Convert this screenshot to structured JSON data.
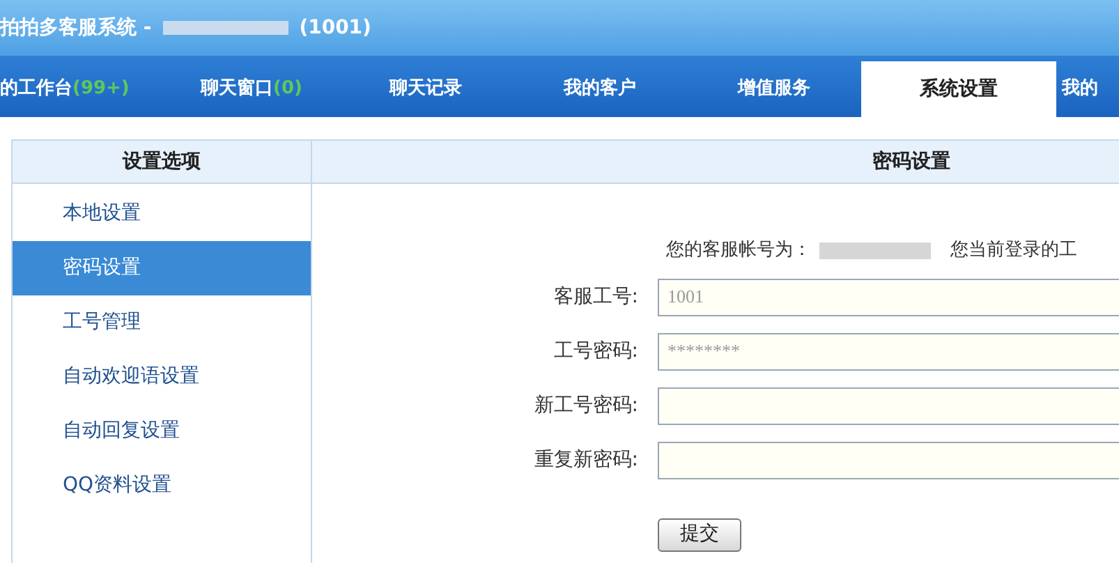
{
  "window": {
    "title": "拍拍多客服系统 -",
    "title_suffix": "(1001)"
  },
  "tabs": [
    {
      "label": "的工作台",
      "count": "(99+)",
      "selected": false
    },
    {
      "label": "聊天窗口",
      "count": "(0)",
      "selected": false
    },
    {
      "label": "聊天记录",
      "selected": false
    },
    {
      "label": "我的客户",
      "selected": false
    },
    {
      "label": "增值服务",
      "selected": false
    },
    {
      "label": "系统设置",
      "selected": true
    },
    {
      "label": "我的",
      "selected": false
    }
  ],
  "sidebar": {
    "title": "设置选项",
    "items": [
      {
        "label": "本地设置",
        "selected": false
      },
      {
        "label": "密码设置",
        "selected": true
      },
      {
        "label": "工号管理",
        "selected": false
      },
      {
        "label": "自动欢迎语设置",
        "selected": false
      },
      {
        "label": "自动回复设置",
        "selected": false
      },
      {
        "label": "QQ资料设置",
        "selected": false
      }
    ]
  },
  "content": {
    "title": "密码设置",
    "account_label": "您的客服帐号为：",
    "login_note": "您当前登录的工",
    "fields": [
      {
        "label": "客服工号:",
        "value": "1001"
      },
      {
        "label": "工号密码:",
        "value": "********"
      },
      {
        "label": "新工号密码:"
      },
      {
        "label": "重复新密码:"
      }
    ],
    "submit": "提交"
  }
}
